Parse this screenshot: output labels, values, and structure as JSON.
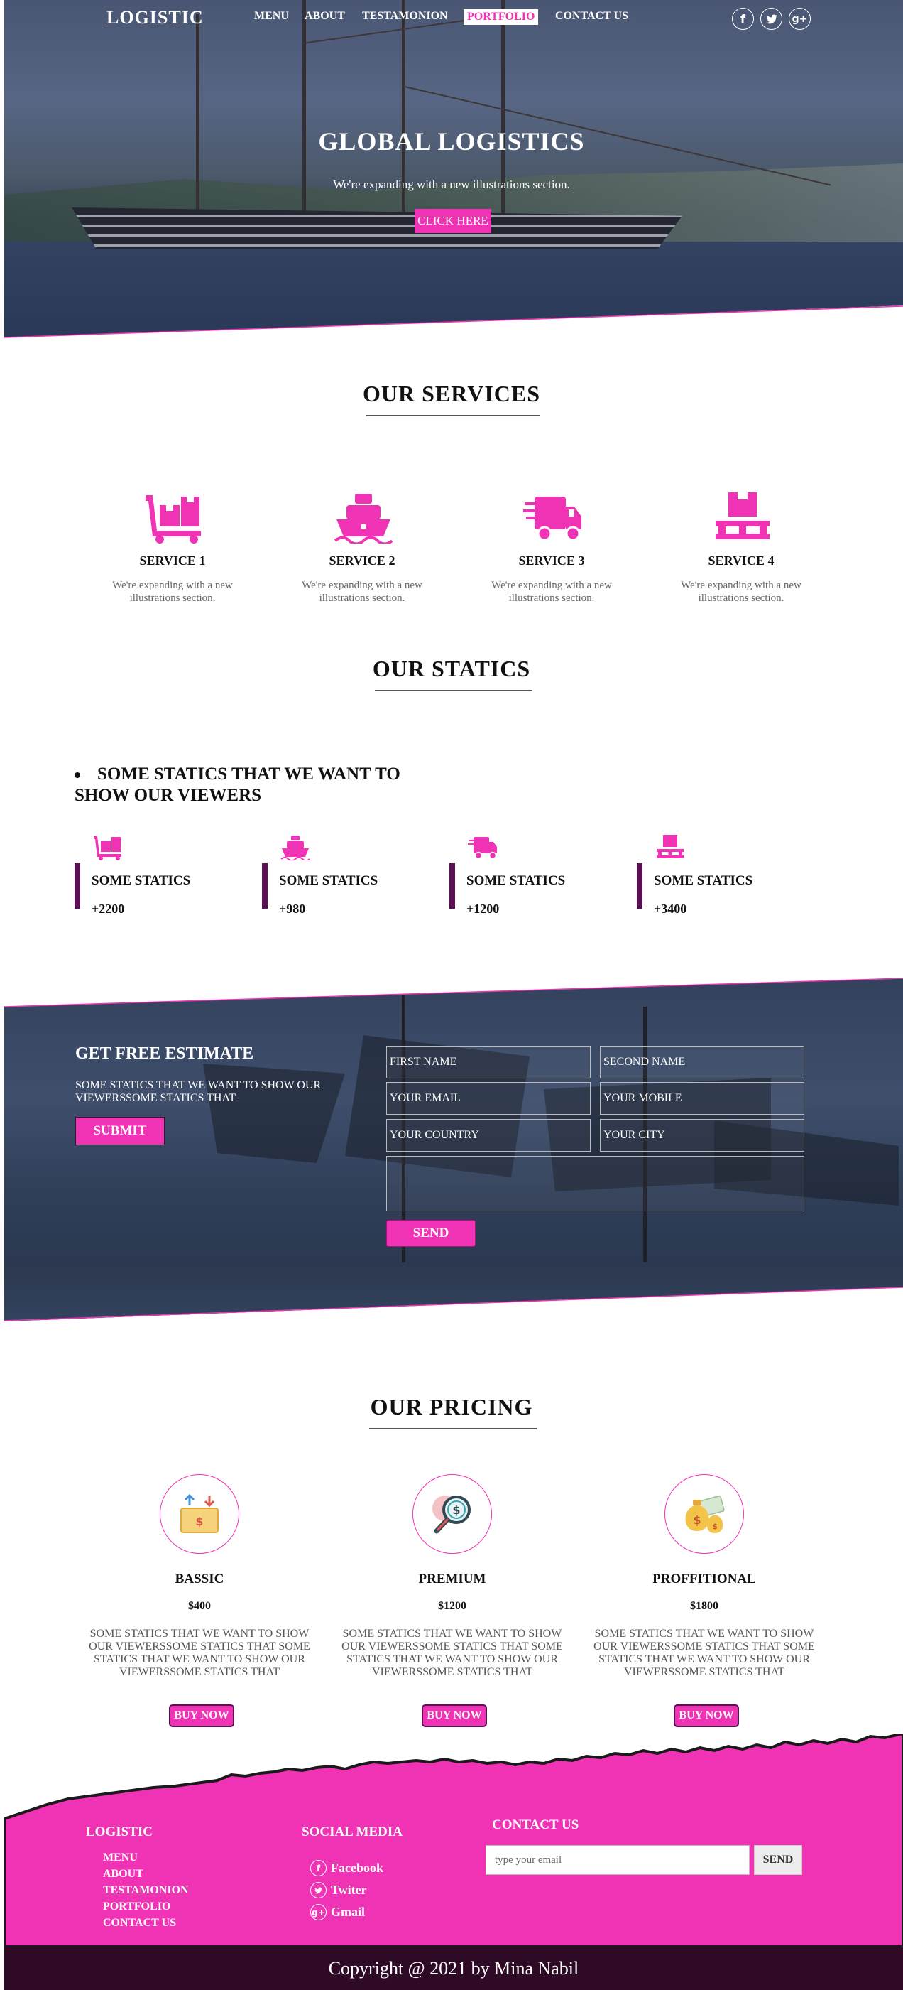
{
  "header": {
    "logo": "LOGISTIC",
    "nav": [
      {
        "label": "MENU"
      },
      {
        "label": "ABOUT"
      },
      {
        "label": "TESTAMONION"
      },
      {
        "label": "PORTFOLIO",
        "active": true
      },
      {
        "label": "CONTACT US"
      }
    ],
    "social": [
      {
        "icon": "facebook-icon",
        "glyph": "f"
      },
      {
        "icon": "twitter-icon",
        "glyph": "🐦"
      },
      {
        "icon": "google-plus-icon",
        "glyph": "g+"
      }
    ]
  },
  "hero": {
    "title": "GLOBAL  LOGISTICS",
    "subtitle": "We're expanding with a new illustrations section.",
    "button": "CLICK HERE"
  },
  "services": {
    "title": "OUR SERVICES",
    "items": [
      {
        "icon": "dolly-boxes-icon",
        "title": "SERVICE 1",
        "text": "We're expanding with a new illustrations section."
      },
      {
        "icon": "ship-icon",
        "title": "SERVICE 2",
        "text": "We're expanding with a new illustrations section."
      },
      {
        "icon": "shipping-truck-icon",
        "title": "SERVICE 3",
        "text": "We're expanding with a new illustrations section."
      },
      {
        "icon": "pallet-box-icon",
        "title": "SERVICE 4",
        "text": "We're expanding with a new illustrations section."
      }
    ]
  },
  "statics": {
    "title": "OUR STATICS",
    "heading": "SOME STATICS THAT WE WANT TO SHOW OUR VIEWERS",
    "items": [
      {
        "icon": "dolly-boxes-icon",
        "label": "SOME STATICS",
        "value": "+2200"
      },
      {
        "icon": "ship-icon",
        "label": "SOME STATICS",
        "value": "+980"
      },
      {
        "icon": "shipping-truck-icon",
        "label": "SOME STATICS",
        "value": "+1200"
      },
      {
        "icon": "pallet-box-icon",
        "label": "SOME STATICS",
        "value": "+3400"
      }
    ]
  },
  "estimate": {
    "title": "GET FREE ESTIMATE",
    "text": "SOME STATICS THAT WE WANT TO SHOW OUR VIEWERSSOME STATICS THAT",
    "submit": "SUBMIT",
    "fields": {
      "first_name": "FIRST NAME",
      "second_name": "SECOND NAME",
      "email": "YOUR EMAIL",
      "mobile": "YOUR MOBILE",
      "country": "YOUR COUNTRY",
      "city": "YOUR CITY",
      "message": ""
    },
    "send": "SEND"
  },
  "pricing": {
    "title": "OUR PRICING",
    "plans": [
      {
        "icon": "money-box-icon",
        "name": "BASSIC",
        "price": "$400",
        "text": "SOME STATICS THAT WE WANT TO SHOW OUR VIEWERSSOME STATICS THAT SOME STATICS THAT WE WANT TO SHOW OUR VIEWERSSOME STATICS THAT",
        "button": "BUY NOW"
      },
      {
        "icon": "dollar-magnifier-icon",
        "name": "PREMIUM",
        "price": "$1200",
        "text": "SOME STATICS THAT WE WANT TO SHOW OUR VIEWERSSOME STATICS THAT SOME STATICS THAT WE WANT TO SHOW OUR VIEWERSSOME STATICS THAT",
        "button": "BUY NOW"
      },
      {
        "icon": "money-bags-icon",
        "name": "PROFFITIONAL",
        "price": "$1800",
        "text": "SOME STATICS THAT WE WANT TO SHOW OUR VIEWERSSOME STATICS THAT SOME STATICS THAT WE WANT TO SHOW OUR VIEWERSSOME STATICS THAT",
        "button": "BUY NOW"
      }
    ]
  },
  "footer": {
    "logo": "LOGISTIC",
    "links": [
      "MENU",
      "ABOUT",
      "TESTAMONION",
      "PORTFOLIO",
      "CONTACT US"
    ],
    "social_title": "SOCIAL MEDIA",
    "social": [
      {
        "icon": "facebook-icon",
        "glyph": "f",
        "label": "Facebook"
      },
      {
        "icon": "twitter-icon",
        "glyph": "t",
        "label": "Twiter"
      },
      {
        "icon": "google-plus-icon",
        "glyph": "g+",
        "label": "Gmail"
      }
    ],
    "contact_title": "CONTACT US",
    "email_placeholder": "type your email",
    "send": "SEND",
    "copyright": "Copyright @ 2021 by Mina Nabil"
  },
  "colors": {
    "accent": "#f032b4",
    "dark_purple": "#5a0f55",
    "footer_bottom": "#2e0a26"
  }
}
